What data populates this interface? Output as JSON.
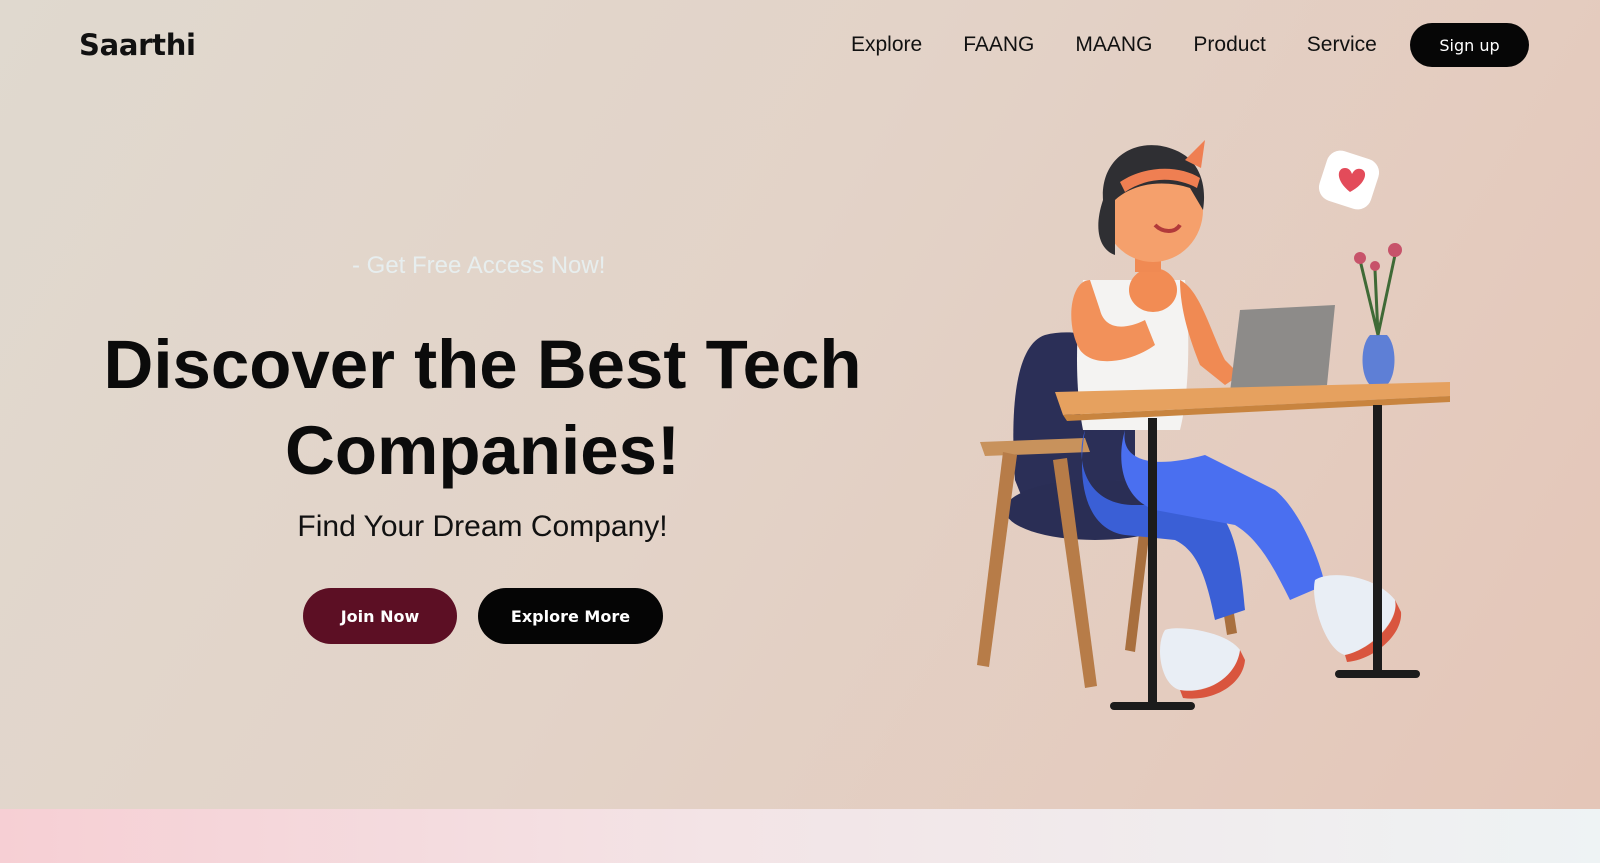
{
  "header": {
    "brand": "Saarthi",
    "nav": [
      {
        "label": "Explore"
      },
      {
        "label": "FAANG"
      },
      {
        "label": "MAANG"
      },
      {
        "label": "Product"
      },
      {
        "label": "Service"
      }
    ],
    "signup_label": "Sign up"
  },
  "hero": {
    "tagline": "- Get Free Access Now!",
    "headline_line1": "Discover the Best Tech",
    "headline_line2": "Companies!",
    "subheadline": "Find Your Dream Company!",
    "join_label": "Join Now",
    "explore_label": "Explore More"
  },
  "colors": {
    "join_button": "#5c0f24",
    "explore_button": "#050505",
    "signup_button": "#060606",
    "tagline": "#e8f1f3"
  },
  "icons": {
    "illustration": "girl-at-desk-illustration",
    "heart": "heart-icon"
  }
}
